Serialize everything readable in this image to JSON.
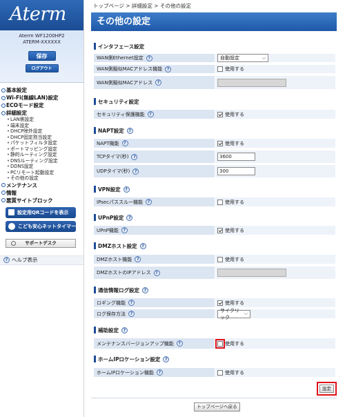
{
  "sidebar": {
    "logo": "Aterm",
    "device_model": "Aterm  WF1200HP2",
    "device_id": "ATERM-XXXXXX",
    "save_label": "保存",
    "logout_label": "ログアウト",
    "nav": [
      {
        "label": "基本設定"
      },
      {
        "label": "Wi-Fi(無線LAN)設定"
      },
      {
        "label": "ECOモード設定"
      },
      {
        "label": "詳細設定"
      },
      {
        "label": "メンテナンス"
      },
      {
        "label": "情報"
      },
      {
        "label": "悪質サイトブロック"
      }
    ],
    "detail_items": [
      "LAN側設定",
      "端末設定",
      "DHCP除外設定",
      "DHCP固定割当設定",
      "パケットフィルタ設定",
      "ポートマッピング設定",
      "静的ルーティング設定",
      "DNSルーティング設定",
      "DDNS設定",
      "PCリモート起動設定",
      "その他の設定"
    ],
    "qr_label": "設定用QRコードを表示",
    "timer_label": "こども安心ネットタイマー",
    "support_label": "サポートデスク",
    "help_label": "ヘルプ表示"
  },
  "breadcrumb": "トップページ > 詳細設定 > その他の設定",
  "title": "その他の設定",
  "sections": {
    "interface": {
      "title": "インタフェース設定"
    },
    "security": {
      "title": "セキュリティ設定"
    },
    "napt": {
      "title": "NAPT設定"
    },
    "vpn": {
      "title": "VPN設定"
    },
    "upnp": {
      "title": "UPnP設定"
    },
    "dmz": {
      "title": "DMZホスト設定"
    },
    "log": {
      "title": "通信情報ログ設定"
    },
    "aux": {
      "title": "補助設定"
    },
    "homeip": {
      "title": "ホームIPロケーション設定"
    }
  },
  "rows": {
    "wan_eth": {
      "label": "WAN側Ethernet設定",
      "value": "自動設定"
    },
    "wan_mac_func": {
      "label": "WAN側擬似MACアドレス機能",
      "value": "使用する"
    },
    "wan_mac_addr": {
      "label": "WAN側擬似MACアドレス"
    },
    "sec_func": {
      "label": "セキュリティ保護機能",
      "value": "使用する"
    },
    "napt_func": {
      "label": "NAPT機能",
      "value": "使用する"
    },
    "tcp_timer": {
      "label": "TCPタイマ(秒)",
      "value": "3600"
    },
    "udp_timer": {
      "label": "UDPタイマ(秒)",
      "value": "300"
    },
    "ipsec": {
      "label": "IPsecパススルー機能",
      "value": "使用する"
    },
    "upnp_func": {
      "label": "UPnP機能",
      "value": "使用する"
    },
    "dmz_func": {
      "label": "DMZホスト機能",
      "value": "使用する"
    },
    "dmz_ip": {
      "label": "DMZホストのIPアドレス"
    },
    "logging": {
      "label": "ロギング機能",
      "value": "使用する"
    },
    "log_method": {
      "label": "ログ保存方法",
      "value": "サイクリック"
    },
    "maint_ver": {
      "label": "メンテナンスバージョンアップ機能",
      "value": "使用する"
    },
    "homeip_func": {
      "label": "ホームIPロケーション機能",
      "value": "使用する"
    }
  },
  "buttons": {
    "set": "設定",
    "top": "トップページへ戻る"
  }
}
